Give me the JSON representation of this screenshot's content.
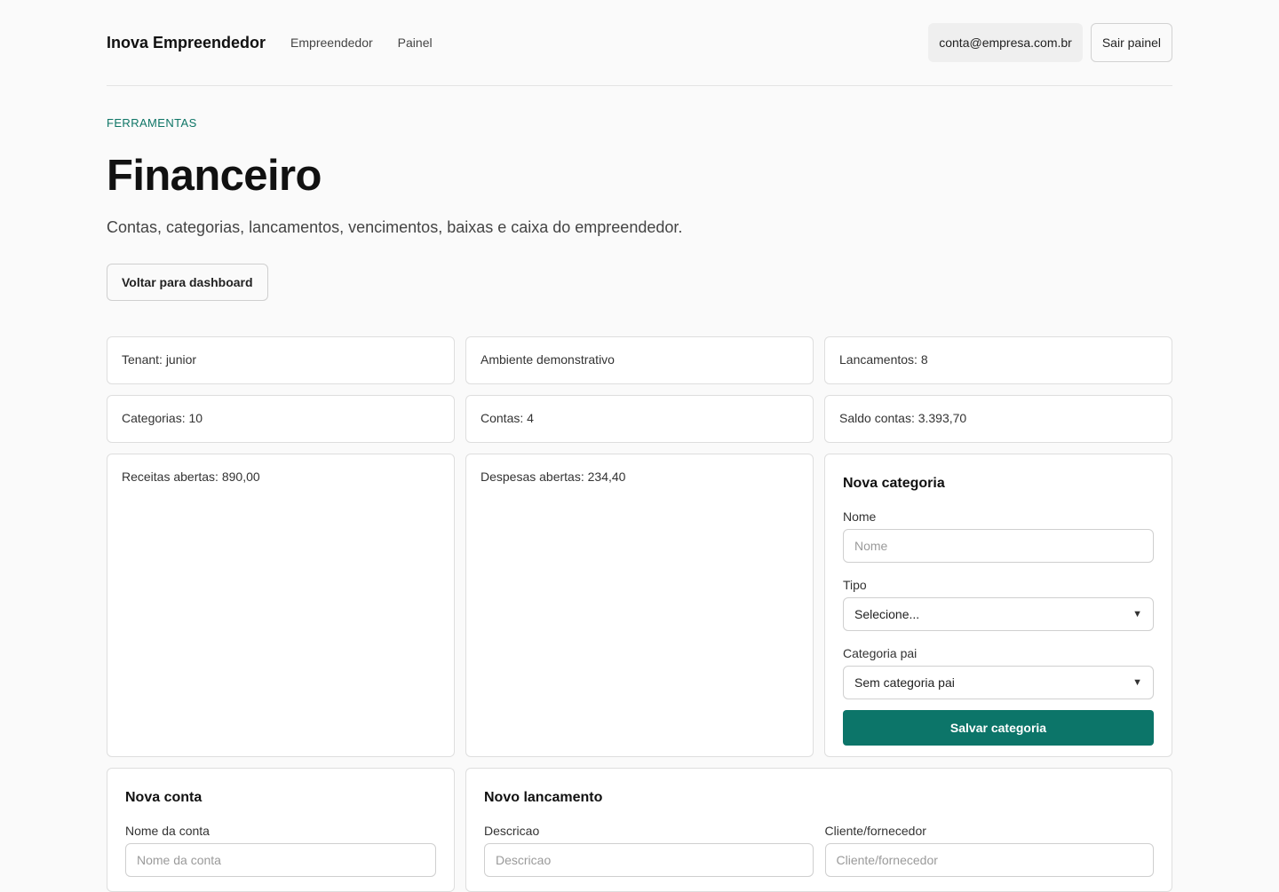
{
  "header": {
    "brand": "Inova Empreendedor",
    "nav": [
      "Empreendedor",
      "Painel"
    ],
    "email": "conta@empresa.com.br",
    "logout_label": "Sair painel"
  },
  "page": {
    "eyebrow": "FERRAMENTAS",
    "title": "Financeiro",
    "subtitle": "Contas, categorias, lancamentos, vencimentos, baixas e caixa do empreendedor.",
    "back_label": "Voltar para dashboard"
  },
  "stats": {
    "tenant": "Tenant: junior",
    "environment": "Ambiente demonstrativo",
    "entries": "Lancamentos: 8",
    "categories": "Categorias: 10",
    "accounts": "Contas: 4",
    "balance": "Saldo contas: 3.393,70",
    "open_income": "Receitas abertas: 890,00",
    "open_expenses": "Despesas abertas: 234,40"
  },
  "new_category": {
    "title": "Nova categoria",
    "name_label": "Nome",
    "name_placeholder": "Nome",
    "type_label": "Tipo",
    "type_value": "Selecione...",
    "parent_label": "Categoria pai",
    "parent_value": "Sem categoria pai",
    "submit_label": "Salvar categoria"
  },
  "new_account": {
    "title": "Nova conta",
    "name_label": "Nome da conta",
    "name_placeholder": "Nome da conta"
  },
  "new_entry": {
    "title": "Novo lancamento",
    "description_label": "Descricao",
    "description_placeholder": "Descricao",
    "party_label": "Cliente/fornecedor",
    "party_placeholder": "Cliente/fornecedor"
  },
  "colors": {
    "accent": "#0c7569",
    "eyebrow": "#0e7566",
    "background": "#fafafa"
  }
}
